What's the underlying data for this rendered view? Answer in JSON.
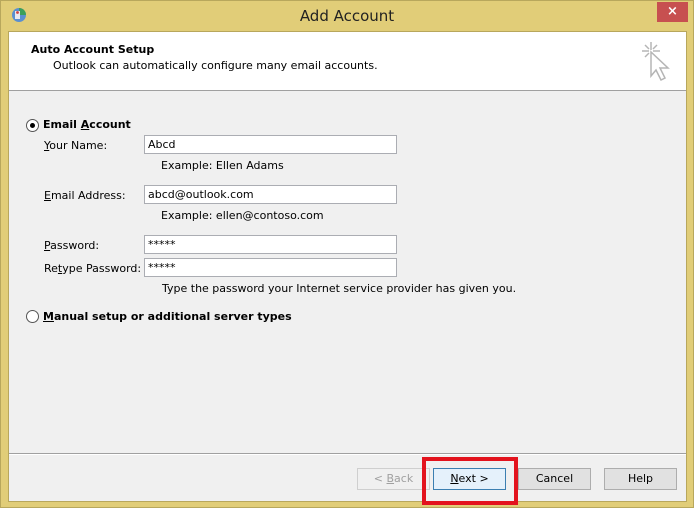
{
  "window": {
    "title": "Add Account",
    "close_label": "×"
  },
  "header": {
    "title": "Auto Account Setup",
    "subtitle": "Outlook can automatically configure many email accounts."
  },
  "options": {
    "email_account": {
      "label_pre": "Email ",
      "label_ul": "A",
      "label_post": "ccount",
      "selected": true
    },
    "manual": {
      "label_pre": "",
      "label_ul": "M",
      "label_post": "anual setup or additional server types",
      "selected": false
    }
  },
  "form": {
    "name": {
      "label_ul": "Y",
      "label_post": "our Name:",
      "value": "Abcd",
      "example": "Example: Ellen Adams"
    },
    "email": {
      "label_ul": "E",
      "label_post": "mail Address:",
      "value": "abcd@outlook.com",
      "example": "Example: ellen@contoso.com"
    },
    "password": {
      "label_ul": "P",
      "label_post": "assword:",
      "value": "*****"
    },
    "retype": {
      "label_pre": "Re",
      "label_ul": "t",
      "label_post": "ype Password:",
      "value": "*****"
    },
    "hint": "Type the password your Internet service provider has given you."
  },
  "buttons": {
    "back": {
      "pre": "< ",
      "ul": "B",
      "post": "ack",
      "enabled": false
    },
    "next": {
      "pre": "",
      "ul": "N",
      "post": "ext >",
      "enabled": true
    },
    "cancel": "Cancel",
    "help": "Help"
  },
  "annotation": {
    "highlight_color": "#e3131d",
    "target": "next-button"
  }
}
